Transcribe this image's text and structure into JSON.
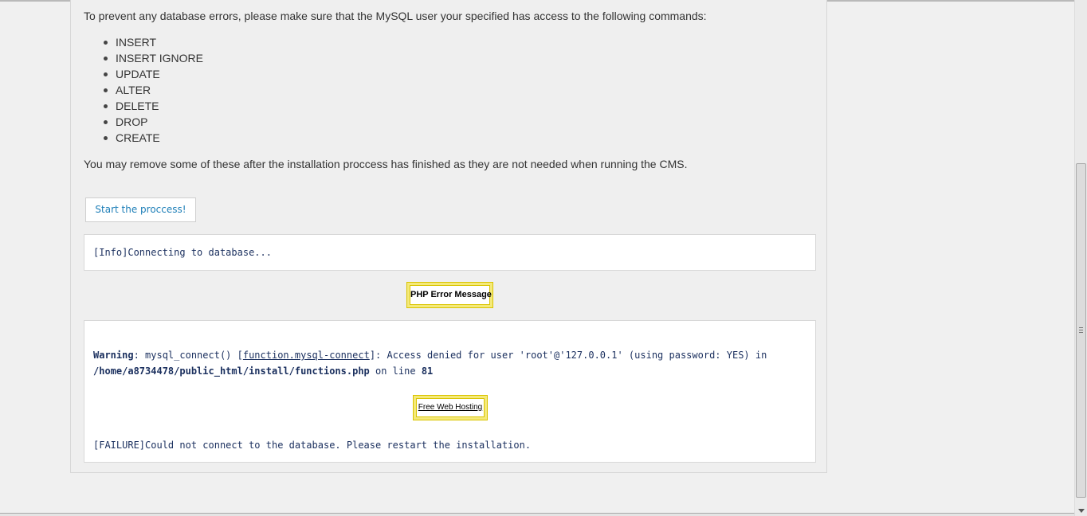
{
  "intro": {
    "text": "To prevent any database errors, please make sure that the MySQL user your specified has access to the following commands:"
  },
  "commands": [
    "INSERT",
    "INSERT IGNORE",
    "UPDATE",
    "ALTER",
    "DELETE",
    "DROP",
    "CREATE"
  ],
  "remove_note": "You may remove some of these after the installation proccess has finished as they are not needed when running the CMS.",
  "start_button": {
    "label": "Start the proccess!"
  },
  "log_info": "[Info]Connecting to database...",
  "php_error_badge": "PHP Error Message",
  "warning": {
    "label": "Warning",
    "text_a": ": mysql_connect() [",
    "link": "function.mysql-connect",
    "text_b": "]: Access denied for user 'root'@'127.0.0.1' (using password: YES) in",
    "path": "/home/a8734478/public_html/install/functions.php",
    "text_c": " on line ",
    "line": "81"
  },
  "hosting_badge": "Free Web Hosting",
  "failure": "[FAILURE]Could not connect to the database. Please restart the installation."
}
